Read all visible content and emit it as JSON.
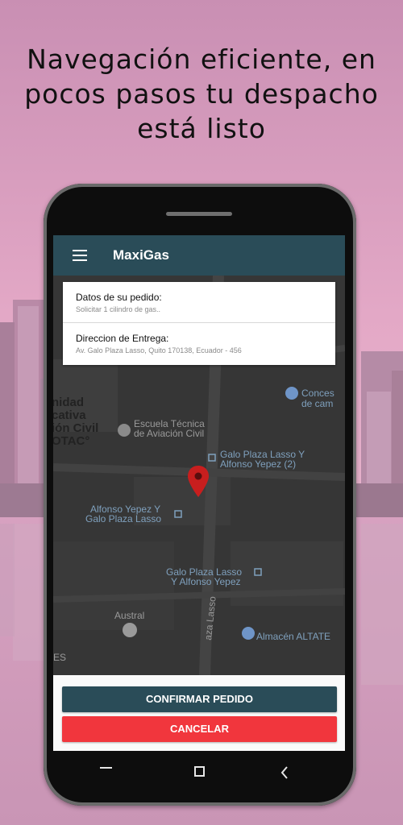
{
  "headline": {
    "line1": "Navegación eficiente, en",
    "line2": "pocos pasos tu despacho",
    "line3": "está listo"
  },
  "app": {
    "title": "MaxiGas",
    "menu_icon": "hamburger-menu-icon"
  },
  "order_card": {
    "details_label": "Datos de su pedido:",
    "details_value": "Solicitar 1 cilindro de gas..",
    "address_label": "Direccion de Entrega:",
    "address_value": "Av. Galo Plaza Lasso, Quito 170138, Ecuador - 456"
  },
  "map": {
    "labels": {
      "unidad_1": "nidad",
      "unidad_2": "cativa",
      "unidad_3": "ión Civil",
      "unidad_4": "OTAC°",
      "escuela_1": "Escuela Técnica",
      "escuela_2": "de Aviación Civil",
      "galo_yepez2_1": "Galo Plaza Lasso Y",
      "galo_yepez2_2": "Alfonso Yepez (2)",
      "yepez_galo_1": "Alfonso Yepez Y",
      "yepez_galo_2": "Galo Plaza Lasso",
      "galo_yepez_1": "Galo Plaza Lasso",
      "galo_yepez_2": "Y Alfonso Yepez",
      "austral": "Austral",
      "concesion_1": "Conces",
      "concesion_2": "de cam",
      "almacen": "Almacén ALTATE",
      "street": "aza Lasso",
      "es": "ES"
    },
    "pin_color": "#c81e1e"
  },
  "actions": {
    "confirm_label": "CONFIRMAR PEDIDO",
    "cancel_label": "CANCELAR",
    "confirm_color": "#2a4c58",
    "cancel_color": "#f1363d"
  },
  "system_nav": {
    "recents_icon": "minus-icon",
    "home_icon": "square-icon",
    "back_icon": "chevron-left-icon"
  }
}
